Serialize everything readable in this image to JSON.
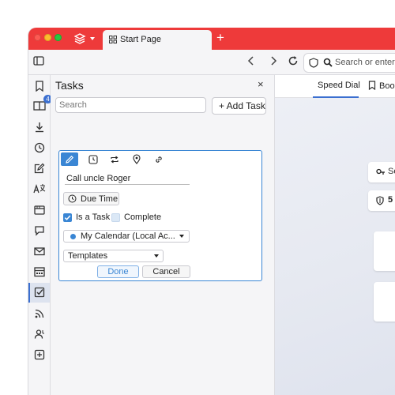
{
  "browser": {
    "tab_title": "Start Page",
    "address_placeholder": "Search or enter an"
  },
  "panel": {
    "title": "Tasks",
    "close_glyph": "×",
    "search_placeholder": "Search",
    "add_task_label": "+ Add Task"
  },
  "editor": {
    "tabs": [
      "pencil-icon",
      "clock-icon",
      "repeat-icon",
      "location-icon",
      "link-icon"
    ],
    "task_title": "Call uncle Roger",
    "due_time_label": "Due Time",
    "is_task_label": "Is a Task",
    "is_task_checked": true,
    "complete_label": "Complete",
    "complete_checked": false,
    "calendar_value": "My Calendar (Local Ac...",
    "calendar_color": "#3a86d4",
    "templates_value": "Templates",
    "done_label": "Done",
    "cancel_label": "Cancel"
  },
  "main": {
    "tab_speed_dial": "Speed Dial",
    "tab_bookmarks": "Boo",
    "card1_text": "Se",
    "card2_text": "5"
  },
  "sidebar": {
    "mail_badge_count": "4",
    "icons": [
      "bookmarks-icon",
      "reading-list-icon",
      "downloads-icon",
      "history-icon",
      "notes-icon",
      "translate-icon",
      "window-icon",
      "chat-icon",
      "mail-icon",
      "calendar-icon",
      "tasks-icon",
      "feeds-icon",
      "contacts-icon",
      "add-panel-icon"
    ]
  },
  "colors": {
    "titlebar": "#ee3a3a",
    "accent": "#3a86d4"
  }
}
